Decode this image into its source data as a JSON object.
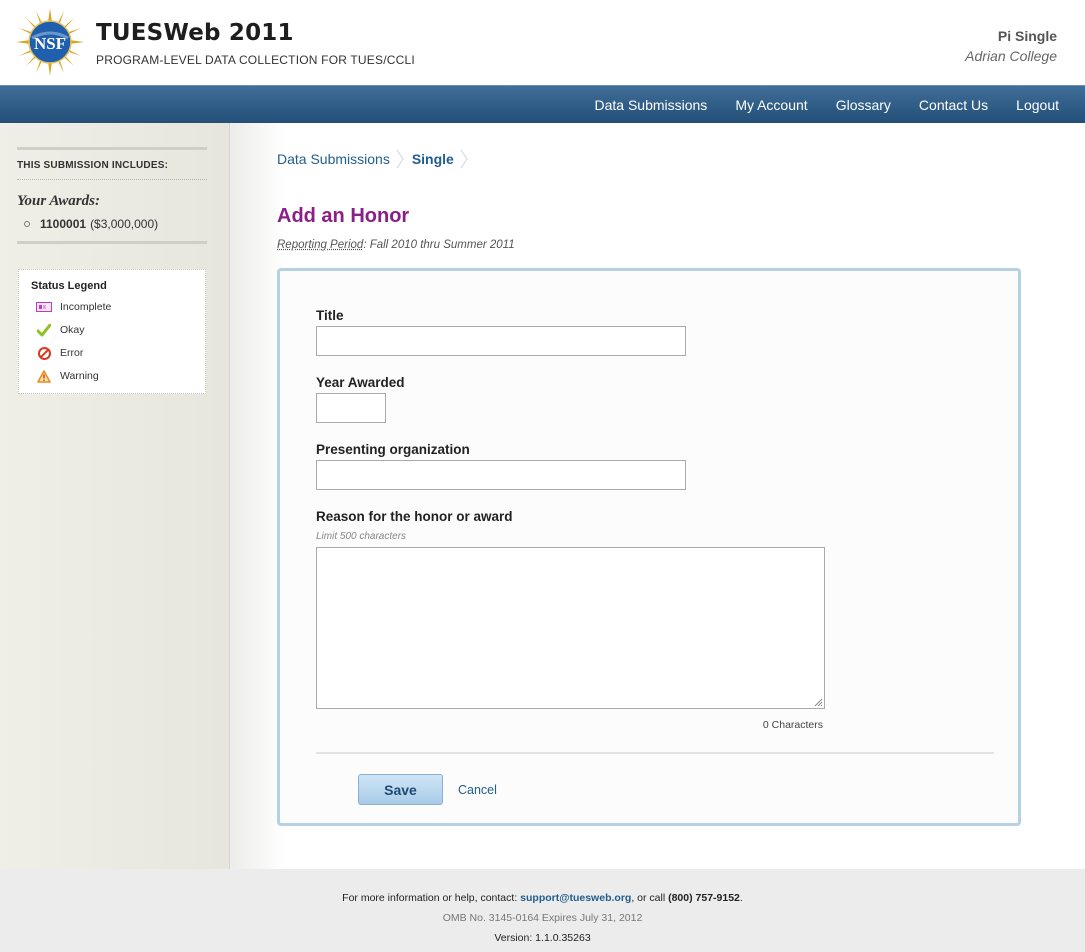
{
  "header": {
    "title": "TUESWeb 2011",
    "subtitle": "PROGRAM-LEVEL DATA COLLECTION FOR TUES/CCLI",
    "logo_text": "NSF",
    "user_name": "Pi Single",
    "user_org": "Adrian College"
  },
  "nav": {
    "items": [
      {
        "label": "Data Submissions"
      },
      {
        "label": "My Account"
      },
      {
        "label": "Glossary"
      },
      {
        "label": "Contact Us"
      },
      {
        "label": "Logout"
      }
    ]
  },
  "sidebar": {
    "heading": "THIS SUBMISSION INCLUDES:",
    "awards_title": "Your Awards:",
    "award_id": "1100001",
    "award_amount": "($3,000,000)",
    "legend": {
      "title": "Status Legend",
      "items": [
        {
          "label": "Incomplete",
          "icon": "incomplete-icon",
          "color": "#c23cb8"
        },
        {
          "label": "Okay",
          "icon": "check-icon",
          "color": "#8cc31f"
        },
        {
          "label": "Error",
          "icon": "error-icon",
          "color": "#d9391f"
        },
        {
          "label": "Warning",
          "icon": "warning-icon",
          "color": "#e8891f"
        }
      ]
    }
  },
  "breadcrumb": {
    "link": "Data Submissions",
    "current": "Single"
  },
  "page": {
    "title": "Add an Honor",
    "reporting_label": "Reporting Period",
    "reporting_value": ": Fall 2010 thru Summer 2011"
  },
  "form": {
    "title_label": "Title",
    "title_value": "",
    "year_label": "Year Awarded",
    "year_value": "",
    "org_label": "Presenting organization",
    "org_value": "",
    "reason_label": "Reason for the honor or award",
    "reason_hint": "Limit 500 characters",
    "reason_value": "",
    "char_count": "0 Characters",
    "save_label": "Save",
    "cancel_label": "Cancel"
  },
  "footer": {
    "help_prefix": "For more information or help, contact: ",
    "help_email": "support@tuesweb.org",
    "help_mid": ", or call ",
    "help_phone": "(800) 757-9152",
    "help_suffix": ".",
    "omb": "OMB No. 3145-0164 Expires July 31, 2012",
    "version": "Version: 1.1.0.35263"
  },
  "colors": {
    "nav": "#2f5d87",
    "title_purple": "#8a1f86",
    "link_blue": "#215e8e",
    "panel_border": "#b6d1e2"
  }
}
